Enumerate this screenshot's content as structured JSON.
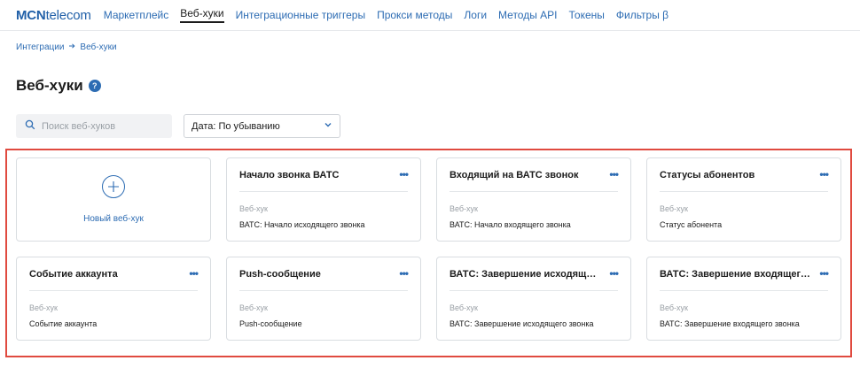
{
  "header": {
    "logo_bold": "MCN",
    "logo_light": "telecom",
    "nav": [
      {
        "label": "Маркетплейс"
      },
      {
        "label": "Веб-хуки"
      },
      {
        "label": "Интеграционные триггеры"
      },
      {
        "label": "Прокси методы"
      },
      {
        "label": "Логи"
      },
      {
        "label": "Методы API"
      },
      {
        "label": "Токены"
      },
      {
        "label": "Фильтры β"
      }
    ],
    "active_index": 1
  },
  "breadcrumb": {
    "root": "Интеграции",
    "current": "Веб-хуки"
  },
  "page": {
    "title": "Веб-хуки",
    "help_glyph": "?"
  },
  "filters": {
    "search_placeholder": "Поиск веб-хуков",
    "sort_value": "Дата: По убыванию"
  },
  "new_card": {
    "label": "Новый веб-хук"
  },
  "cards": [
    {
      "name": "Начало звонка ВАТС",
      "type": "Веб-хук",
      "trigger": "ВАТС: Начало исходящего звонка"
    },
    {
      "name": "Входящий на ВАТС звонок",
      "type": "Веб-хук",
      "trigger": "ВАТС: Начало входящего звонка"
    },
    {
      "name": "Статусы абонентов",
      "type": "Веб-хук",
      "trigger": "Статус абонента"
    },
    {
      "name": "Событие аккаунта",
      "type": "Веб-хук",
      "trigger": "Событие аккаунта"
    },
    {
      "name": "Push-сообщение",
      "type": "Веб-хук",
      "trigger": "Push-сообщение"
    },
    {
      "name": "ВАТС: Завершение исходящего звонка",
      "type": "Веб-хук",
      "trigger": "ВАТС: Завершение исходящего звонка"
    },
    {
      "name": "ВАТС: Завершение входящего звонка",
      "type": "Веб-хук",
      "trigger": "ВАТС: Завершение входящего звонка"
    }
  ],
  "icons": {
    "more": "more-horizontal-icon",
    "plus": "plus-circle-icon",
    "search": "search-icon",
    "chevron": "chevron-down-icon",
    "arrow": "arrow-right-icon"
  },
  "colors": {
    "accent": "#2d6cb3",
    "highlight_frame": "#e04a3f"
  }
}
